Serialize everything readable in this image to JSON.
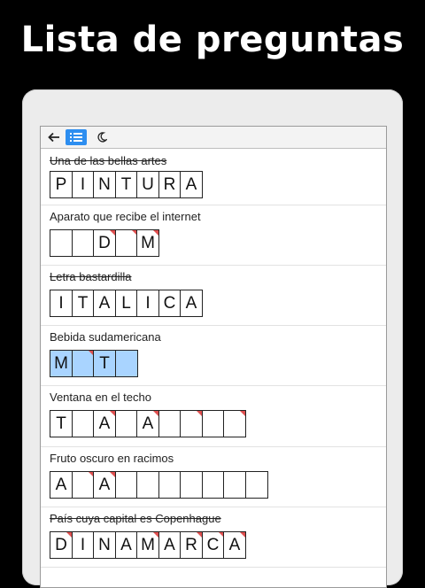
{
  "header": {
    "title": "Lista de preguntas"
  },
  "toolbar": {
    "back_icon": "arrow-left-icon",
    "list_icon": "list-icon",
    "night_icon": "moon-icon",
    "active_color": "#2d8ef0"
  },
  "questions": [
    {
      "clue": "Una de las bellas artes",
      "solved": true,
      "cells": [
        {
          "l": "P"
        },
        {
          "l": "I"
        },
        {
          "l": "N"
        },
        {
          "l": "T"
        },
        {
          "l": "U"
        },
        {
          "l": "R"
        },
        {
          "l": "A"
        }
      ]
    },
    {
      "clue": "Aparato que recibe el internet",
      "solved": false,
      "cells": [
        {
          "l": ""
        },
        {
          "l": ""
        },
        {
          "l": "D",
          "mark": true
        },
        {
          "l": "",
          "mark": true
        },
        {
          "l": "M",
          "mark": true
        }
      ]
    },
    {
      "clue": "Letra bastardilla",
      "solved": true,
      "cells": [
        {
          "l": "I"
        },
        {
          "l": "T"
        },
        {
          "l": "A"
        },
        {
          "l": "L"
        },
        {
          "l": "I"
        },
        {
          "l": "C"
        },
        {
          "l": "A"
        }
      ]
    },
    {
      "clue": "Bebida sudamericana",
      "solved": false,
      "highlight": true,
      "cells": [
        {
          "l": "M"
        },
        {
          "l": "",
          "mark": true
        },
        {
          "l": "T"
        },
        {
          "l": ""
        }
      ]
    },
    {
      "clue": "Ventana en el techo",
      "solved": false,
      "cells": [
        {
          "l": "T"
        },
        {
          "l": ""
        },
        {
          "l": "A",
          "mark": true
        },
        {
          "l": ""
        },
        {
          "l": "A",
          "mark": true
        },
        {
          "l": ""
        },
        {
          "l": "",
          "mark": true
        },
        {
          "l": ""
        },
        {
          "l": "",
          "mark": true
        }
      ]
    },
    {
      "clue": "Fruto oscuro en racimos",
      "solved": false,
      "cells": [
        {
          "l": "A"
        },
        {
          "l": "",
          "mark": true
        },
        {
          "l": "A",
          "mark": true
        },
        {
          "l": ""
        },
        {
          "l": ""
        },
        {
          "l": ""
        },
        {
          "l": ""
        },
        {
          "l": ""
        },
        {
          "l": ""
        },
        {
          "l": ""
        }
      ]
    },
    {
      "clue": "País cuya capital es Copenhague",
      "solved": true,
      "cells": [
        {
          "l": "D",
          "mark": true
        },
        {
          "l": "I"
        },
        {
          "l": "N"
        },
        {
          "l": "A"
        },
        {
          "l": "M",
          "mark": true
        },
        {
          "l": "A"
        },
        {
          "l": "R",
          "mark": true
        },
        {
          "l": "C",
          "mark": true
        },
        {
          "l": "A",
          "mark": true
        }
      ]
    }
  ]
}
